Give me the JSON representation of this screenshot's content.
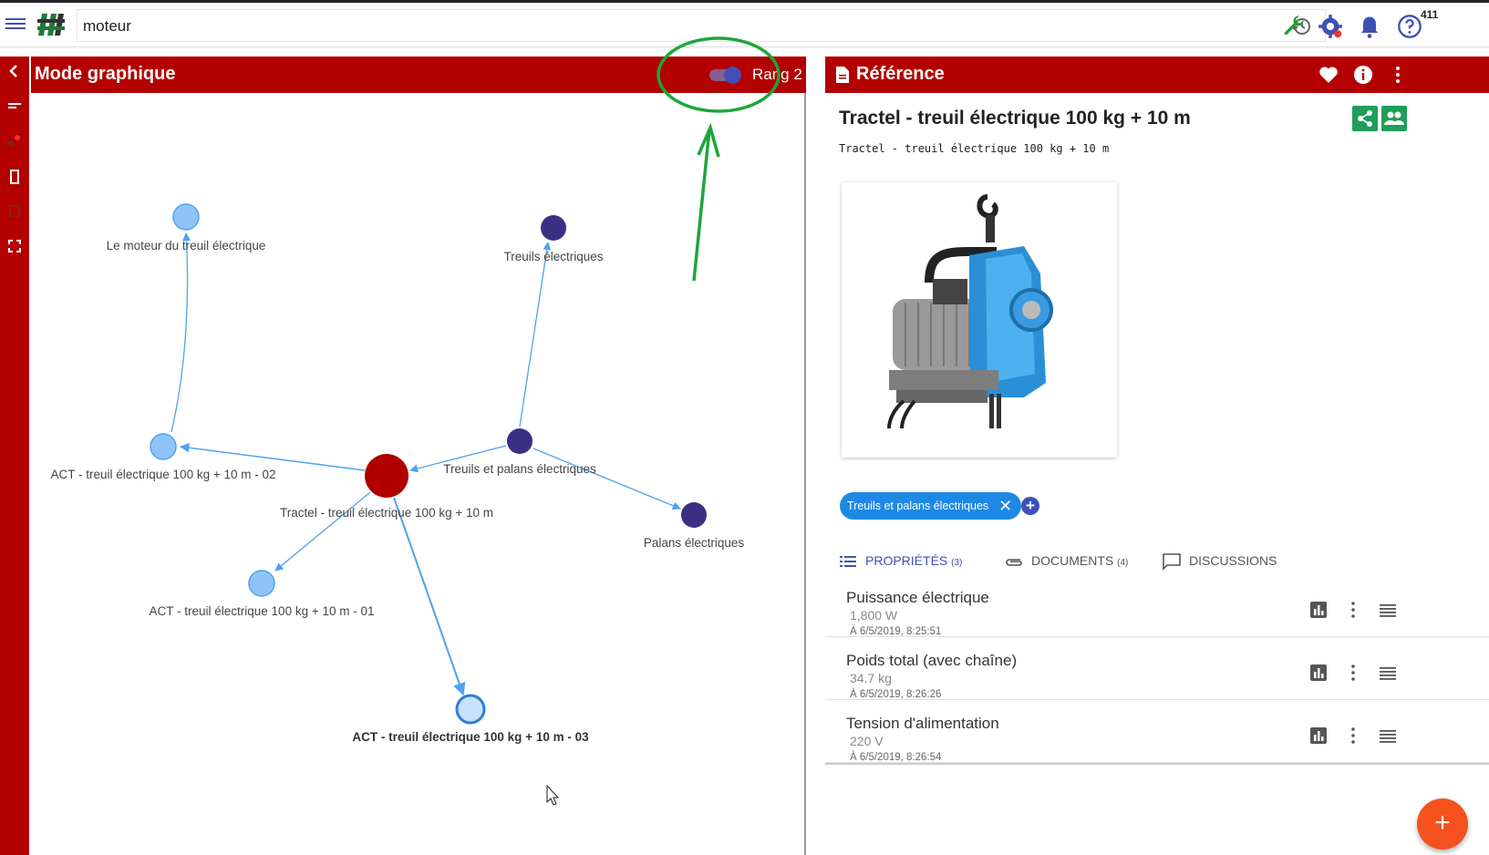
{
  "search": {
    "value": "moteur"
  },
  "topbar": {
    "notification_count": "411"
  },
  "graph_panel": {
    "title": "Mode graphique",
    "rank_label": "Rang 2",
    "rank_toggle_on": true,
    "nodes": [
      {
        "label": "Le moteur du treuil électrique",
        "kind": "light"
      },
      {
        "label": "Treuils électriques",
        "kind": "dark"
      },
      {
        "label": "ACT - treuil électrique 100 kg + 10 m -  02",
        "kind": "light"
      },
      {
        "label": "Treuils et palans électriques",
        "kind": "dark"
      },
      {
        "label": "Tractel - treuil électrique 100 kg + 10 m",
        "kind": "selected"
      },
      {
        "label": "Palans électriques",
        "kind": "dark"
      },
      {
        "label": "ACT - treuil électrique 100 kg + 10 m -  01",
        "kind": "light"
      },
      {
        "label": "ACT - treuil électrique 100 kg + 10 m - 03",
        "kind": "highlighted"
      }
    ]
  },
  "reference_panel": {
    "header": "Référence",
    "title": "Tractel - treuil électrique 100 kg + 10 m",
    "subtitle": "Tractel - treuil électrique 100 kg + 10 m",
    "tag": "Treuils et palans électriques",
    "tabs": [
      {
        "label": "PROPRIÉTÉS",
        "count": "(3)",
        "active": true
      },
      {
        "label": "DOCUMENTS",
        "count": "(4)",
        "active": false
      },
      {
        "label": "DISCUSSIONS",
        "count": "",
        "active": false
      }
    ],
    "properties": [
      {
        "name": "Puissance électrique",
        "value": "1,800 W",
        "date": "À 6/5/2019, 8:25:51"
      },
      {
        "name": "Poids total (avec chaîne)",
        "value": "34.7 kg",
        "date": "À 6/5/2019, 8:26:26"
      },
      {
        "name": "Tension d'alimentation",
        "value": "220 V",
        "date": "À 6/5/2019, 8:26:54"
      }
    ],
    "fab_label": "+"
  },
  "colors": {
    "header_red": "#b30000",
    "node_light": "#90c4f9",
    "node_dark": "#3b2f84",
    "node_selected": "#b00000",
    "edge": "#4da3ef",
    "annotation_green": "#1ea63a",
    "fab": "#f4511e"
  }
}
